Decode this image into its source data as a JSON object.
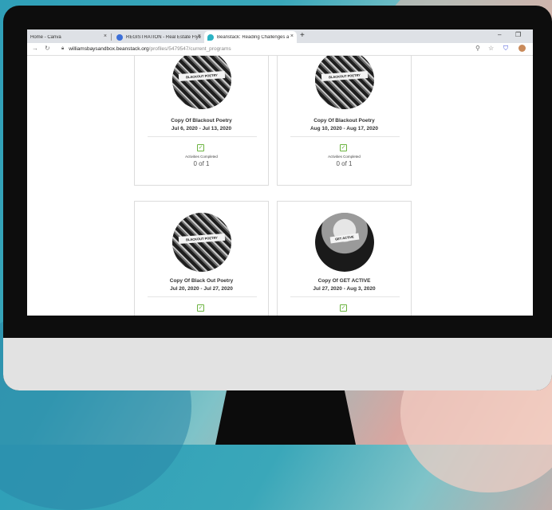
{
  "browser": {
    "tabs": [
      {
        "title": "Home - Canva",
        "favicon_color": "#ffffff"
      },
      {
        "title": "REGISTRATION - Real Estate Flyer",
        "favicon_color": "#3c6fd8"
      },
      {
        "title": "Beanstack: Reading Challenges a",
        "favicon_color": "#2bb3c4"
      }
    ],
    "new_tab_label": "+",
    "close_label": "×",
    "window_minimize": "–",
    "window_restore": "❐",
    "url_host": "williamsbaysandbox.beanstack.org",
    "url_path": "/profiles/5479547/current_programs"
  },
  "programs": [
    {
      "title": "Copy Of Blackout Poetry",
      "dates": "Jul 6, 2020 - Jul 13, 2020",
      "image_text": "BLACKOUT POETRY",
      "activities_label": "Activities Completed",
      "count": "0 of 1"
    },
    {
      "title": "Copy Of Blackout Poetry",
      "dates": "Aug 10, 2020 - Aug 17, 2020",
      "image_text": "BLACKOUT POETRY",
      "activities_label": "Activities Completed",
      "count": "0 of 1"
    },
    {
      "title": "Copy Of Black Out Poetry",
      "dates": "Jul 20, 2020 - Jul 27, 2020",
      "image_text": "BLACKOUT POETRY"
    },
    {
      "title": "Copy Of GET ACTIVE",
      "dates": "Jul 27, 2020 - Aug 3, 2020",
      "image_text": "GET ACTIVE"
    }
  ],
  "colors": {
    "check": "#6bb33f",
    "accent": "#2bb3c4"
  }
}
